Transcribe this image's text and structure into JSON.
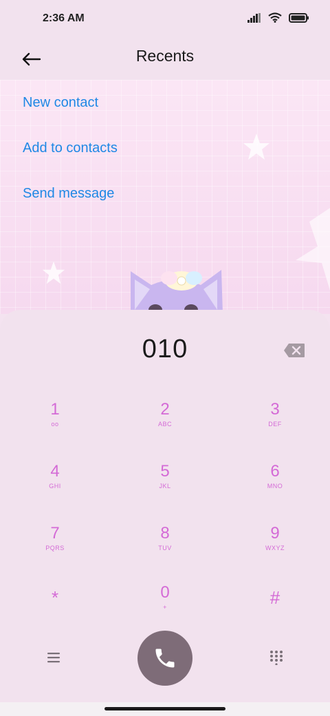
{
  "status_bar": {
    "time": "2:36 AM",
    "icons": [
      "signal-icon",
      "wifi-icon",
      "battery-icon"
    ]
  },
  "header": {
    "title": "Recents",
    "back_icon": "back-arrow-icon"
  },
  "actions": [
    {
      "label": "New contact"
    },
    {
      "label": "Add to contacts"
    },
    {
      "label": "Send message"
    }
  ],
  "dialer": {
    "number": "010",
    "keys": [
      {
        "digit": "1",
        "letters": "oo"
      },
      {
        "digit": "2",
        "letters": "ABC"
      },
      {
        "digit": "3",
        "letters": "DEF"
      },
      {
        "digit": "4",
        "letters": "GHI"
      },
      {
        "digit": "5",
        "letters": "JKL"
      },
      {
        "digit": "6",
        "letters": "MNO"
      },
      {
        "digit": "7",
        "letters": "PQRS"
      },
      {
        "digit": "8",
        "letters": "TUV"
      },
      {
        "digit": "9",
        "letters": "WXYZ"
      },
      {
        "digit": "*",
        "letters": ""
      },
      {
        "digit": "0",
        "letters": "+"
      },
      {
        "digit": "#",
        "letters": ""
      }
    ]
  },
  "colors": {
    "accent_link": "#1e88e5",
    "key_color": "#d46ad6",
    "call_button": "#7e6c78",
    "panel_bg": "#f2e2ee"
  }
}
